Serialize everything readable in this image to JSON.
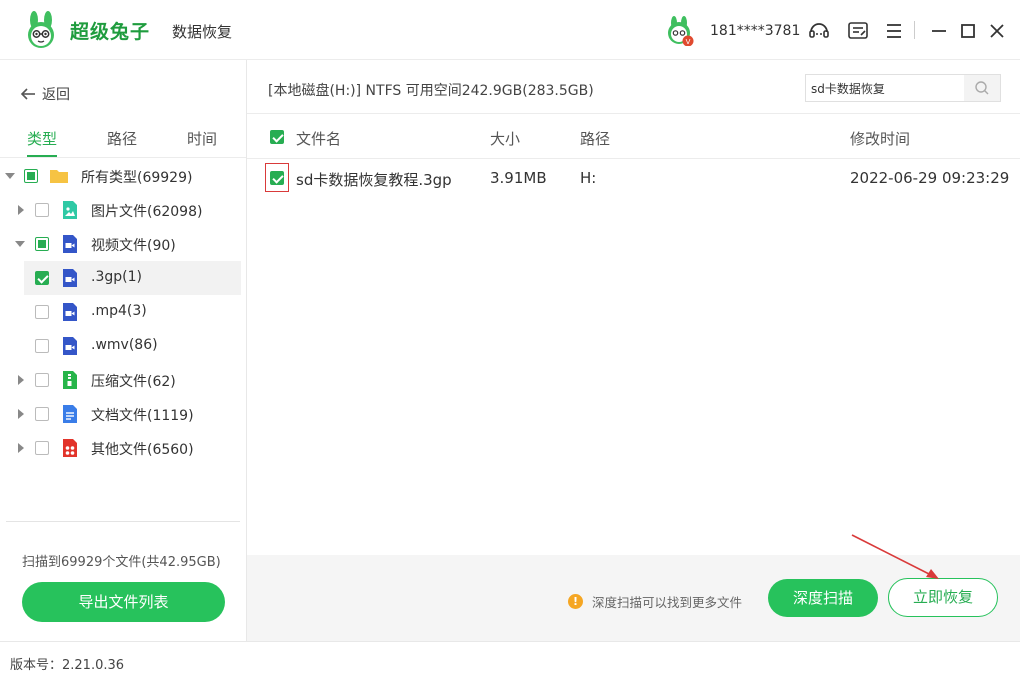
{
  "app": {
    "brand": "超级兔子",
    "subtitle": "数据恢复",
    "user": "181****3781",
    "vip_badge": "V"
  },
  "nav": {
    "back_label": "返回"
  },
  "tabs": [
    "类型",
    "路径",
    "时间"
  ],
  "tree": [
    {
      "label": "所有类型(69929)",
      "icon": "folder-icon",
      "state": "partial",
      "expand": "down"
    },
    {
      "label": "图片文件(62098)",
      "icon": "image-file-icon",
      "state": "unchecked",
      "expand": "right"
    },
    {
      "label": "视频文件(90)",
      "icon": "video-file-icon",
      "state": "partial",
      "expand": "down"
    },
    {
      "label": ".3gp(1)",
      "icon": "video-file-icon",
      "state": "checked",
      "expand": ""
    },
    {
      "label": ".mp4(3)",
      "icon": "video-file-icon",
      "state": "unchecked",
      "expand": ""
    },
    {
      "label": ".wmv(86)",
      "icon": "video-file-icon",
      "state": "unchecked",
      "expand": ""
    },
    {
      "label": "压缩文件(62)",
      "icon": "archive-file-icon",
      "state": "unchecked",
      "expand": "right"
    },
    {
      "label": "文档文件(1119)",
      "icon": "document-file-icon",
      "state": "unchecked",
      "expand": "right"
    },
    {
      "label": "其他文件(6560)",
      "icon": "other-file-icon",
      "state": "unchecked",
      "expand": "right"
    }
  ],
  "sidebar": {
    "scan_info": "扫描到69929个文件(共42.95GB)",
    "export_label": "导出文件列表"
  },
  "main": {
    "path": "[本地磁盘(H:)] NTFS 可用空间242.9GB(283.5GB)",
    "search_value": "sd卡数据恢复",
    "columns": {
      "name": "文件名",
      "size": "大小",
      "path": "路径",
      "mtime": "修改时间"
    },
    "rows": [
      {
        "name": "sd卡数据恢复教程.3gp",
        "size": "3.91MB",
        "path": "H:",
        "mtime": "2022-06-29 09:23:29"
      }
    ],
    "tip": "深度扫描可以找到更多文件",
    "deep_scan_label": "深度扫描",
    "recover_label": "立即恢复"
  },
  "status": {
    "version": "版本号：2.21.0.36"
  },
  "colors": {
    "accent": "#27c25c",
    "accent_text": "#27ad52",
    "warning": "#f5a623",
    "highlight": "#d93a3a"
  }
}
